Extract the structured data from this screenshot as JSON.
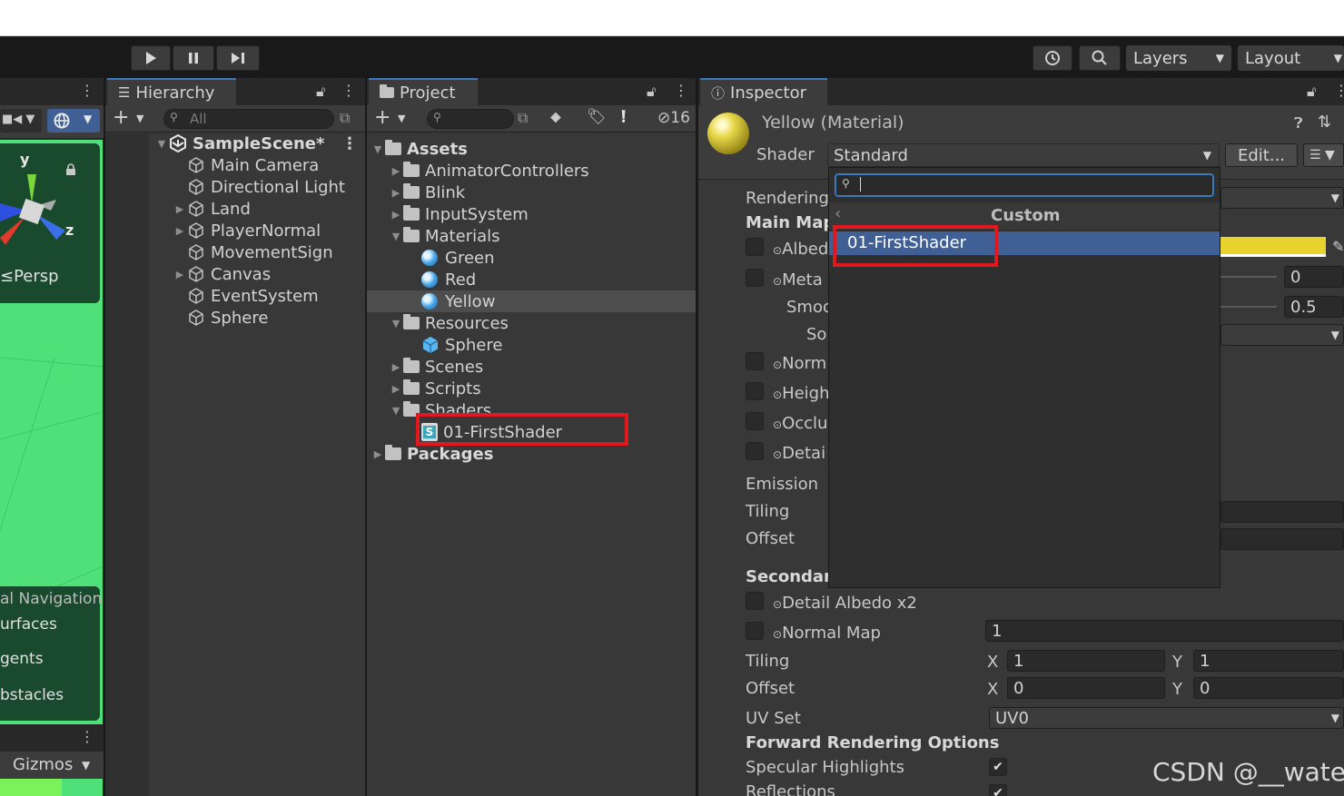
{
  "toolbar": {
    "layers_label": "Layers",
    "layout_label": "Layout"
  },
  "scene": {
    "axis_y": "y",
    "axis_z": "z",
    "persp_label": "Persp",
    "nav_items": [
      "al Navigation",
      "urfaces",
      "gents",
      "bstacles"
    ],
    "gizmos_label": "Gizmos"
  },
  "hierarchy": {
    "tab_label": "Hierarchy",
    "search_placeholder": "All",
    "scene_name": "SampleScene*",
    "items": [
      {
        "label": "Main Camera",
        "expandable": false
      },
      {
        "label": "Directional Light",
        "expandable": false
      },
      {
        "label": "Land",
        "expandable": true
      },
      {
        "label": "PlayerNormal",
        "expandable": true
      },
      {
        "label": "MovementSign",
        "expandable": false
      },
      {
        "label": "Canvas",
        "expandable": true
      },
      {
        "label": "EventSystem",
        "expandable": false
      },
      {
        "label": "Sphere",
        "expandable": false
      }
    ]
  },
  "project": {
    "tab_label": "Project",
    "hidden_count": "16",
    "assets_label": "Assets",
    "folders": [
      "AnimatorControllers",
      "Blink",
      "InputSystem"
    ],
    "materials_folder": "Materials",
    "materials": [
      "Green",
      "Red",
      "Yellow"
    ],
    "resources_folder": "Resources",
    "resources_items": [
      "Sphere"
    ],
    "more_folders": [
      "Scenes",
      "Scripts"
    ],
    "shaders_folder": "Shaders",
    "shader_file": "01-FirstShader",
    "packages_label": "Packages"
  },
  "inspector": {
    "tab_label": "Inspector",
    "material_title": "Yellow (Material)",
    "shader_label": "Shader",
    "shader_value": "Standard",
    "edit_button": "Edit...",
    "rendering_label": "Rendering",
    "main_maps_label": "Main Map",
    "albedo_label": "Albed",
    "metallic_label": "Meta",
    "metallic_value": "0",
    "smoothness_label": "Smoo",
    "smoothness_value": "0.5",
    "source_label": "So",
    "normal_label": "Norm",
    "height_label": "Heigh",
    "occlusion_label": "Occlu",
    "detail_label": "Detai",
    "emission_label": "Emission",
    "tiling_label": "Tiling",
    "offset_label": "Offset",
    "secondary_label": "Secondary",
    "detail_albedo_label": "Detail Albedo x2",
    "normal_map_label": "Normal Map",
    "normal_map_value": "1",
    "sec_tiling_label": "Tiling",
    "sec_offset_label": "Offset",
    "tiling_x": "1",
    "tiling_y": "1",
    "offset_x": "0",
    "offset_y": "0",
    "x_label": "X",
    "y_label": "Y",
    "uvset_label": "UV Set",
    "uvset_value": "UV0",
    "forward_label": "Forward Rendering Options",
    "specular_label": "Specular Highlights",
    "reflections_label": "Reflections",
    "albedo_color": "#e8d22e"
  },
  "dropdown": {
    "category": "Custom",
    "item": "01-FirstShader"
  },
  "watermark": "CSDN @__water",
  "colors": {
    "scene_green": "#4fe07a",
    "highlight_red": "#e0191e",
    "selection_blue": "#3f5f95",
    "focus_blue": "#3a79bb"
  }
}
